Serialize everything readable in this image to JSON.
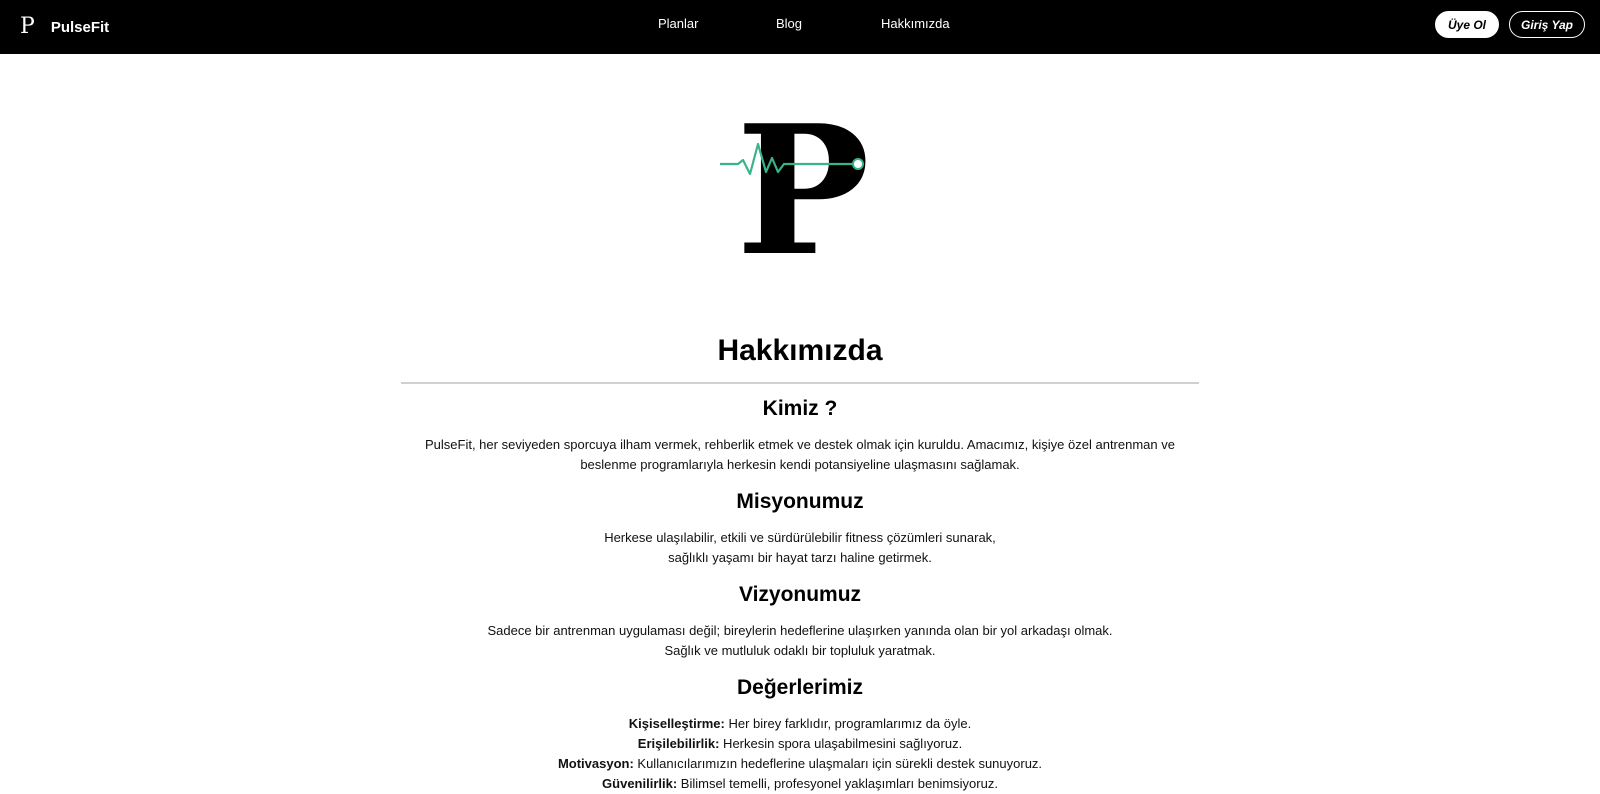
{
  "header": {
    "brand_logo": "P",
    "brand_name": "PulseFit",
    "nav": {
      "plans": "Planlar",
      "blog": "Blog",
      "about": "Hakkımızda"
    },
    "buttons": {
      "signup": "Üye Ol",
      "login": "Giriş Yap"
    }
  },
  "hero": {
    "logo_letter": "P",
    "accent_color": "#3bb38a"
  },
  "main": {
    "title": "Hakkımızda",
    "who": {
      "title": "Kimiz ?",
      "line1": "PulseFit, her seviyeden sporcuya ilham vermek, rehberlik etmek ve destek olmak için kuruldu. Amacımız, kişiye özel antrenman ve",
      "line2": "beslenme programlarıyla herkesin kendi potansiyeline ulaşmasını sağlamak."
    },
    "mission": {
      "title": "Misyonumuz",
      "line1": "Herkese ulaşılabilir, etkili ve sürdürülebilir fitness çözümleri sunarak,",
      "line2": "sağlıklı yaşamı bir hayat tarzı haline getirmek."
    },
    "vision": {
      "title": "Vizyonumuz",
      "line1": "Sadece bir antrenman uygulaması değil; bireylerin hedeflerine ulaşırken yanında olan bir yol arkadaşı olmak.",
      "line2": "Sağlık ve mutluluk odaklı bir topluluk yaratmak."
    },
    "values": {
      "title": "Değerlerimiz",
      "items": [
        {
          "label": "Kişiselleştirme:",
          "text": " Her birey farklıdır, programlarımız da öyle."
        },
        {
          "label": "Erişilebilirlik:",
          "text": " Herkesin spora ulaşabilmesini sağlıyoruz."
        },
        {
          "label": "Motivasyon:",
          "text": " Kullanıcılarımızın hedeflerine ulaşmaları için sürekli destek sunuyoruz."
        },
        {
          "label": "Güvenilirlik:",
          "text": " Bilimsel temelli, profesyonel yaklaşımları benimsiyoruz."
        }
      ]
    }
  }
}
